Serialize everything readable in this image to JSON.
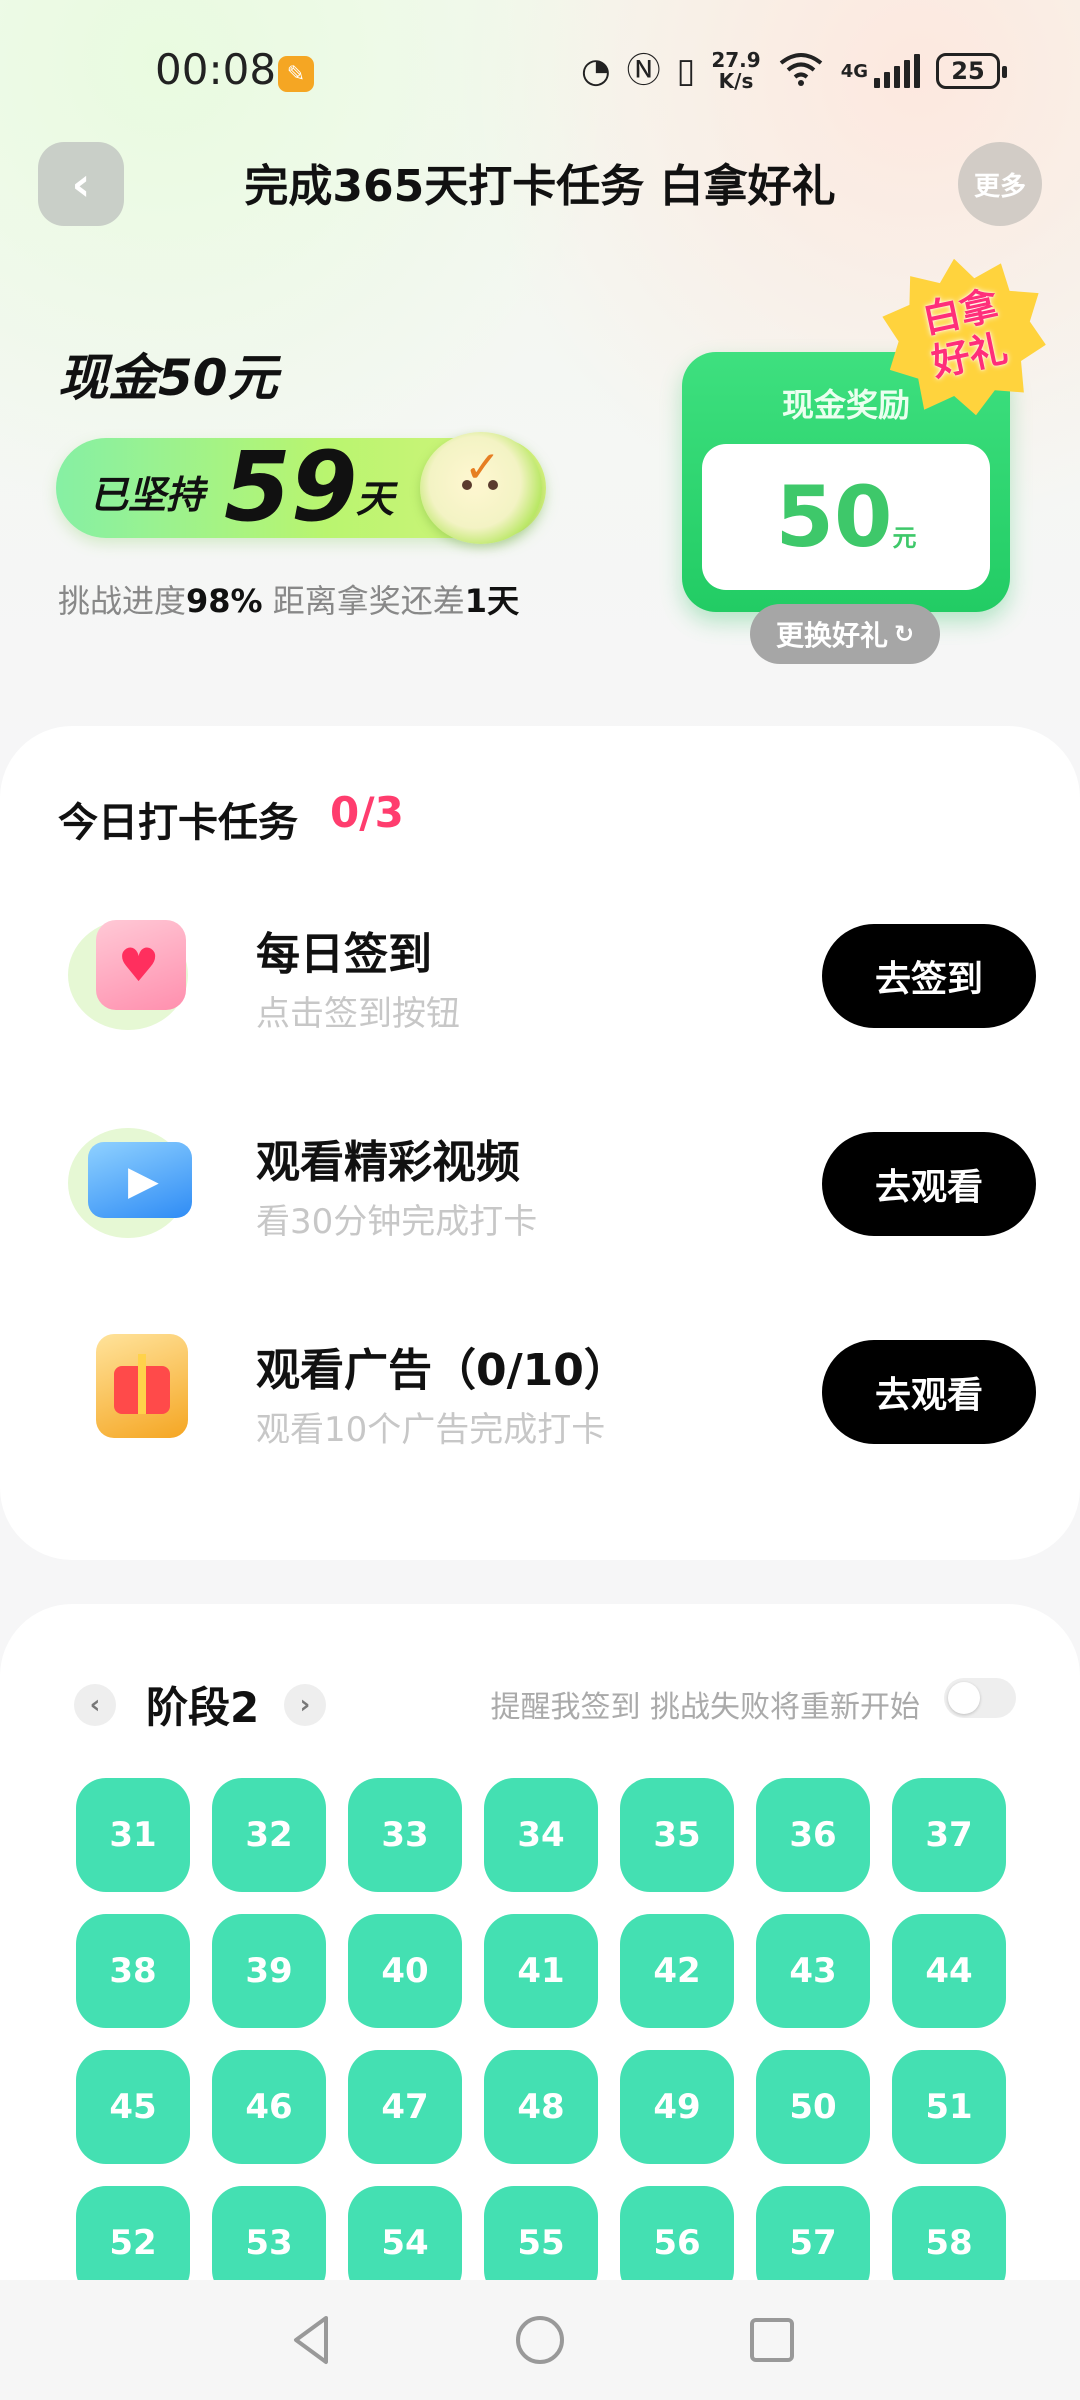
{
  "status_bar": {
    "time": "00:08",
    "app_icon": "notification-app-icon",
    "net_speed_value": "27.9",
    "net_speed_unit": "K/s",
    "network_type": "4G",
    "battery": "25"
  },
  "header": {
    "back_icon": "‹",
    "title": "完成365天打卡任务 白拿好礼",
    "more_label": "更多"
  },
  "hero": {
    "cash_title": "现金50元",
    "persist_label": "已坚持",
    "persist_days": "59",
    "persist_unit": "天",
    "progress_prefix": "挑战进度",
    "progress_percent": "98%",
    "progress_middle": " 距离拿奖还差",
    "remaining_days": "1天"
  },
  "reward": {
    "card_title": "现金奖励",
    "amount": "50",
    "unit": "元",
    "badge_line1": "白拿",
    "badge_line2": "好礼",
    "change_label": "更换好礼",
    "change_icon": "↻"
  },
  "tasks": {
    "heading": "今日打卡任务",
    "count": "0/3",
    "items": [
      {
        "icon": "calendar-heart-icon",
        "title": "每日签到",
        "subtitle": "点击签到按钮",
        "button": "去签到"
      },
      {
        "icon": "video-play-icon",
        "title": "观看精彩视频",
        "subtitle": "看30分钟完成打卡",
        "button": "去观看"
      },
      {
        "icon": "gift-box-icon",
        "title": "观看广告（0/10）",
        "subtitle": "观看10个广告完成打卡",
        "button": "去观看"
      }
    ]
  },
  "stage": {
    "prev_icon": "‹",
    "title": "阶段2",
    "next_icon": "›",
    "reminder_text": "提醒我签到 挑战失败将重新开始",
    "reminder_on": false,
    "days": [
      "31",
      "32",
      "33",
      "34",
      "35",
      "36",
      "37",
      "38",
      "39",
      "40",
      "41",
      "42",
      "43",
      "44",
      "45",
      "46",
      "47",
      "48",
      "49",
      "50",
      "51",
      "52",
      "53",
      "54",
      "55",
      "56",
      "57",
      "58"
    ],
    "day_color": "#44e0b2"
  },
  "colors": {
    "accent_green": "#22cc64",
    "accent_pink": "#ff3d6e",
    "button_black": "#000000"
  }
}
